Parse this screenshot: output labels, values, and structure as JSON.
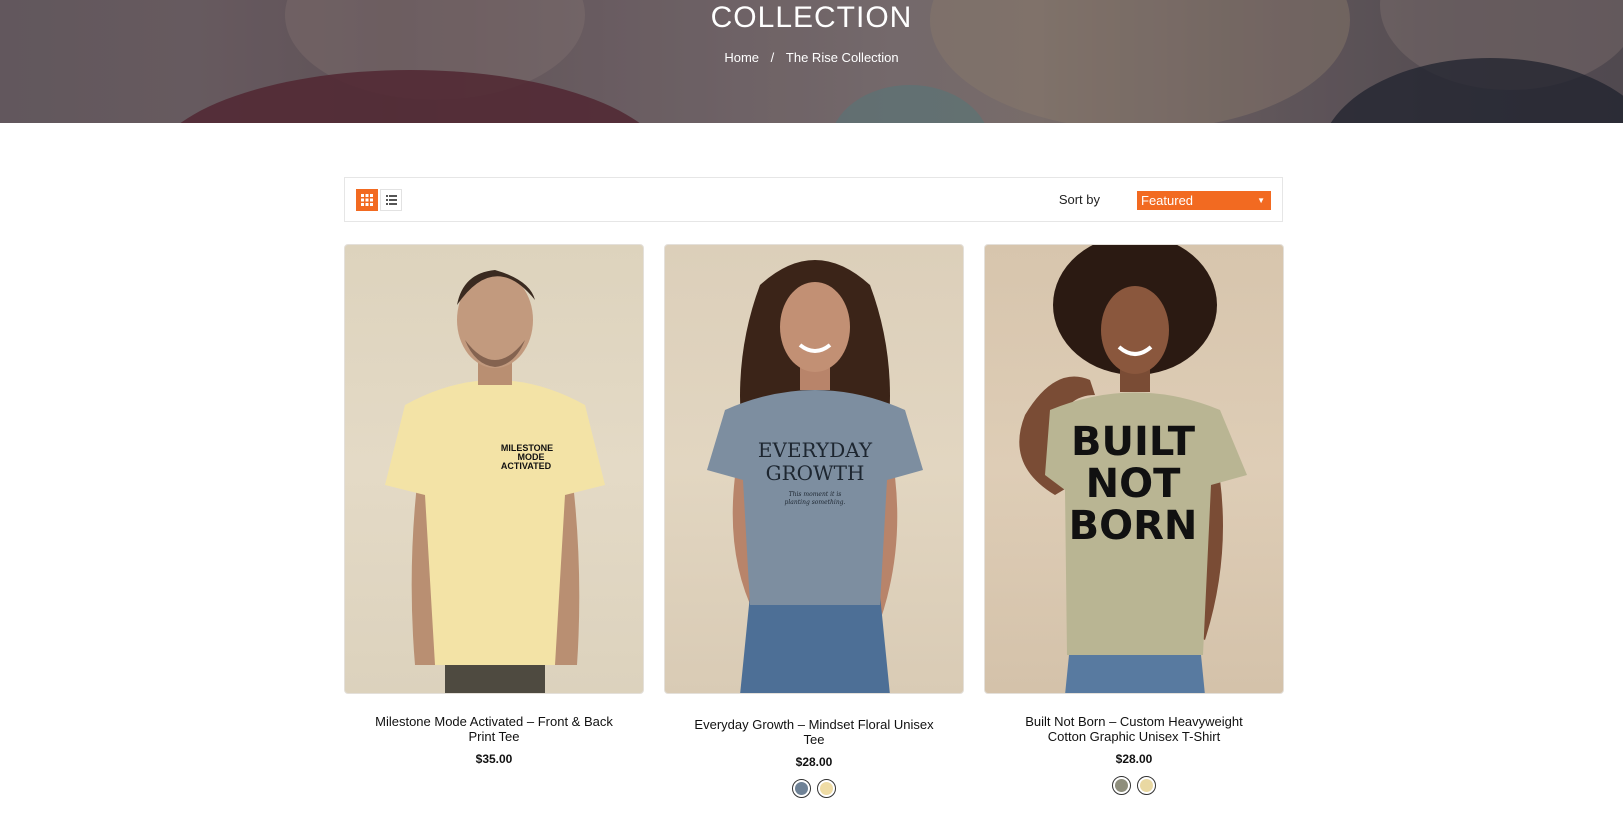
{
  "hero": {
    "title": "COLLECTION",
    "breadcrumb": {
      "home": "Home",
      "separator": "/",
      "current": "The Rise Collection"
    }
  },
  "toolbar": {
    "grid_view_icon": "grid-icon",
    "list_view_icon": "list-icon",
    "sort_label": "Sort by",
    "sort_value": "Featured",
    "accent": "#f26a21"
  },
  "products": [
    {
      "title": "Milestone Mode Activated – Front & Back Print Tee",
      "price": "$35.00",
      "shirt_color": "#f3e3a6",
      "shirt_print": [
        "MILESTONE",
        "MODE",
        "ACTIVATED"
      ],
      "swatches": []
    },
    {
      "title": "Everyday Growth – Mindset Floral Unisex Tee",
      "price": "$28.00",
      "shirt_color": "#7d8ea0",
      "shirt_print": [
        "EVERYDAY",
        "GROWTH",
        "This moment it is",
        "planting something."
      ],
      "swatches": [
        "#6f8296",
        "#efdca5"
      ]
    },
    {
      "title": "Built Not Born – Custom Heavyweight Cotton Graphic Unisex T-Shirt",
      "price": "$28.00",
      "shirt_color": "#b9b593",
      "shirt_print": [
        "BUILT",
        "NOT",
        "BORN"
      ],
      "swatches": [
        "#8e8e7c",
        "#e9d8a2"
      ]
    }
  ]
}
